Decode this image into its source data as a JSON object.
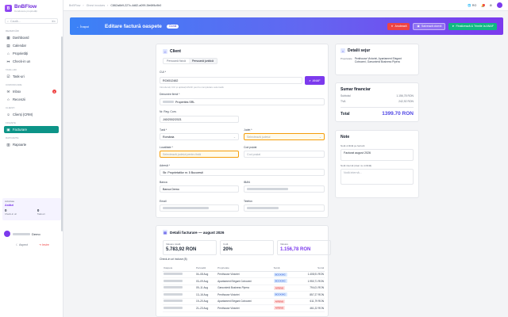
{
  "sidebar": {
    "brand_name": "BnBFlow",
    "brand_sub": "Conducere proprietăți",
    "search_placeholder": "Caută...",
    "search_kbd": "⌘K",
    "sections": [
      {
        "label": "Rezervări",
        "items": [
          {
            "label": "Dashboard",
            "icon": "grid-icon",
            "icon_char": "▦"
          },
          {
            "label": "Calendar",
            "icon": "calendar-icon",
            "icon_char": "▤"
          },
          {
            "label": "Proprietăți",
            "icon": "home-icon",
            "icon_char": "⌂"
          },
          {
            "label": "Check-in un",
            "icon": "checkin-icon",
            "icon_char": "↦"
          }
        ]
      },
      {
        "label": "Task-uri",
        "items": [
          {
            "label": "Task-uri",
            "icon": "tasks-icon",
            "icon_char": "☑"
          }
        ]
      },
      {
        "label": "Comunicare",
        "items": [
          {
            "label": "Inbox",
            "icon": "inbox-icon",
            "icon_char": "✉",
            "badge": "4"
          },
          {
            "label": "Recenzii",
            "icon": "star-icon",
            "icon_char": "☆"
          }
        ]
      },
      {
        "label": "Clienți",
        "items": [
          {
            "label": "Clienți (CRM)",
            "icon": "users-icon",
            "icon_char": "☺"
          }
        ]
      },
      {
        "label": "Finanțe",
        "items": [
          {
            "label": "Facturare",
            "icon": "invoice-icon",
            "icon_char": "▣",
            "active": true
          }
        ]
      },
      {
        "label": "Rapoarte",
        "items": [
          {
            "label": "Rapoarte",
            "icon": "chart-icon",
            "icon_char": "▥"
          }
        ]
      }
    ],
    "activity": {
      "title": "Activitate",
      "label": "Astăzi",
      "n1": "0",
      "n1_label": "Check-in uri",
      "n2": "0",
      "n2_label": "Task-uri"
    },
    "user_suffix": "Demo",
    "footer": {
      "theme": "Aspect",
      "logout": "Ieșire"
    }
  },
  "topbar": {
    "crumbs": [
      "BnBFlow",
      "Ghest invoices",
      "C862a6b9-227c-4d82-a099-3fe6ff4c9b0"
    ],
    "lang": "RO"
  },
  "header": {
    "back": "← Înapoi",
    "title": "Editare factură oaspete",
    "chip": "Ciornă",
    "btn_cancel": "Anulează",
    "btn_save": "Salvează ciornă",
    "btn_finalize": "Finalizează & Trimite la ANAF"
  },
  "client": {
    "title": "Client",
    "toggle": [
      "Persoană fizică",
      "Persoană juridică"
    ],
    "cui_label": "CUI *",
    "cui_value": "RO4512482",
    "anaf_btn": "ANAF",
    "cui_hint": "Introduceți CUI și apăsați ANAF pentru completare automată",
    "company_label": "Denumire firmă *",
    "company_value": "Properties SRL",
    "reg_label": "Nr. Reg. Com.",
    "reg_value": "J40/2002/2021",
    "country_label": "Țară *",
    "country_value": "România",
    "county_label": "Județ *",
    "county_placeholder": "Selectează județul",
    "city_label": "Localitate *",
    "city_placeholder": "Selectează județul pentru listă",
    "zip_label": "Cod poștal",
    "zip_placeholder": "Cod poștal",
    "address_label": "Adresă *",
    "address_value": "Str. Proprietatilor nr. 5 București",
    "bank_label": "Banca",
    "bank_value": "Banca Demo",
    "iban_label": "IBAN",
    "email_label": "Email",
    "phone_label": "Telefon"
  },
  "stay": {
    "title": "Detalii sejur",
    "room_label": "Proprietate",
    "room_value": "Penthouse Victoriei, Apartament Elegant Cotroceni, Garsonieră Business Pipera"
  },
  "summary": {
    "title": "Sumar financiar",
    "rows": [
      {
        "label": "Subtotal",
        "value": "1.156,78 RON"
      },
      {
        "label": "TVA",
        "value": "242,92 RON"
      }
    ],
    "total_label": "Total",
    "total_value": "1399.70 RON"
  },
  "notes": {
    "title": "Note",
    "label1": "Notă vizibilă pe factură",
    "value1": "Facturat august 2026",
    "label2": "Notă internă (doar nu vizibilă)",
    "placeholder2": "Notă internă..."
  },
  "invoice": {
    "title": "Detalii facturare — august 2026",
    "tiles": [
      {
        "label": "Valoare totală",
        "value": "5.783,92 RON"
      },
      {
        "label": "Cotă",
        "value": "20%"
      },
      {
        "label": "Valoare",
        "value": "1.156,78 RON"
      }
    ],
    "list_label": "Check-in uri incluse (8)",
    "cols": [
      "Oaspete",
      "Perioadă",
      "Proprietate",
      "Sursă",
      "Sumă"
    ],
    "rows": [
      {
        "period": "04–08 Aug",
        "property": "Penthouse Victoriei",
        "source": "BOOKING",
        "amount": "1.408,91 RON"
      },
      {
        "period": "03–09 Aug",
        "property": "Apartament Elegant Cotroceni",
        "source": "BOOKING",
        "amount": "1.950,71 RON"
      },
      {
        "period": "09–11 Aug",
        "property": "Garsonieră Business Pipera",
        "source": "AIRBNB",
        "amount": "794,01 RON"
      },
      {
        "period": "13–16 Aug",
        "property": "Penthouse Victoriei",
        "source": "BOOKING",
        "amount": "857,27 RON"
      },
      {
        "period": "19–20 Aug",
        "property": "Apartament Elegant Cotroceni",
        "source": "AIRBNB",
        "amount": "611,79 RON"
      },
      {
        "period": "21–23 Aug",
        "property": "Penthouse Victoriei",
        "source": "AIRBNB",
        "amount": "461,22 RON"
      }
    ]
  },
  "colors": {
    "accent": "#7c3aed",
    "active_nav": "#0d9488",
    "cancel": "#ef4444",
    "finalize": "#10b981"
  }
}
